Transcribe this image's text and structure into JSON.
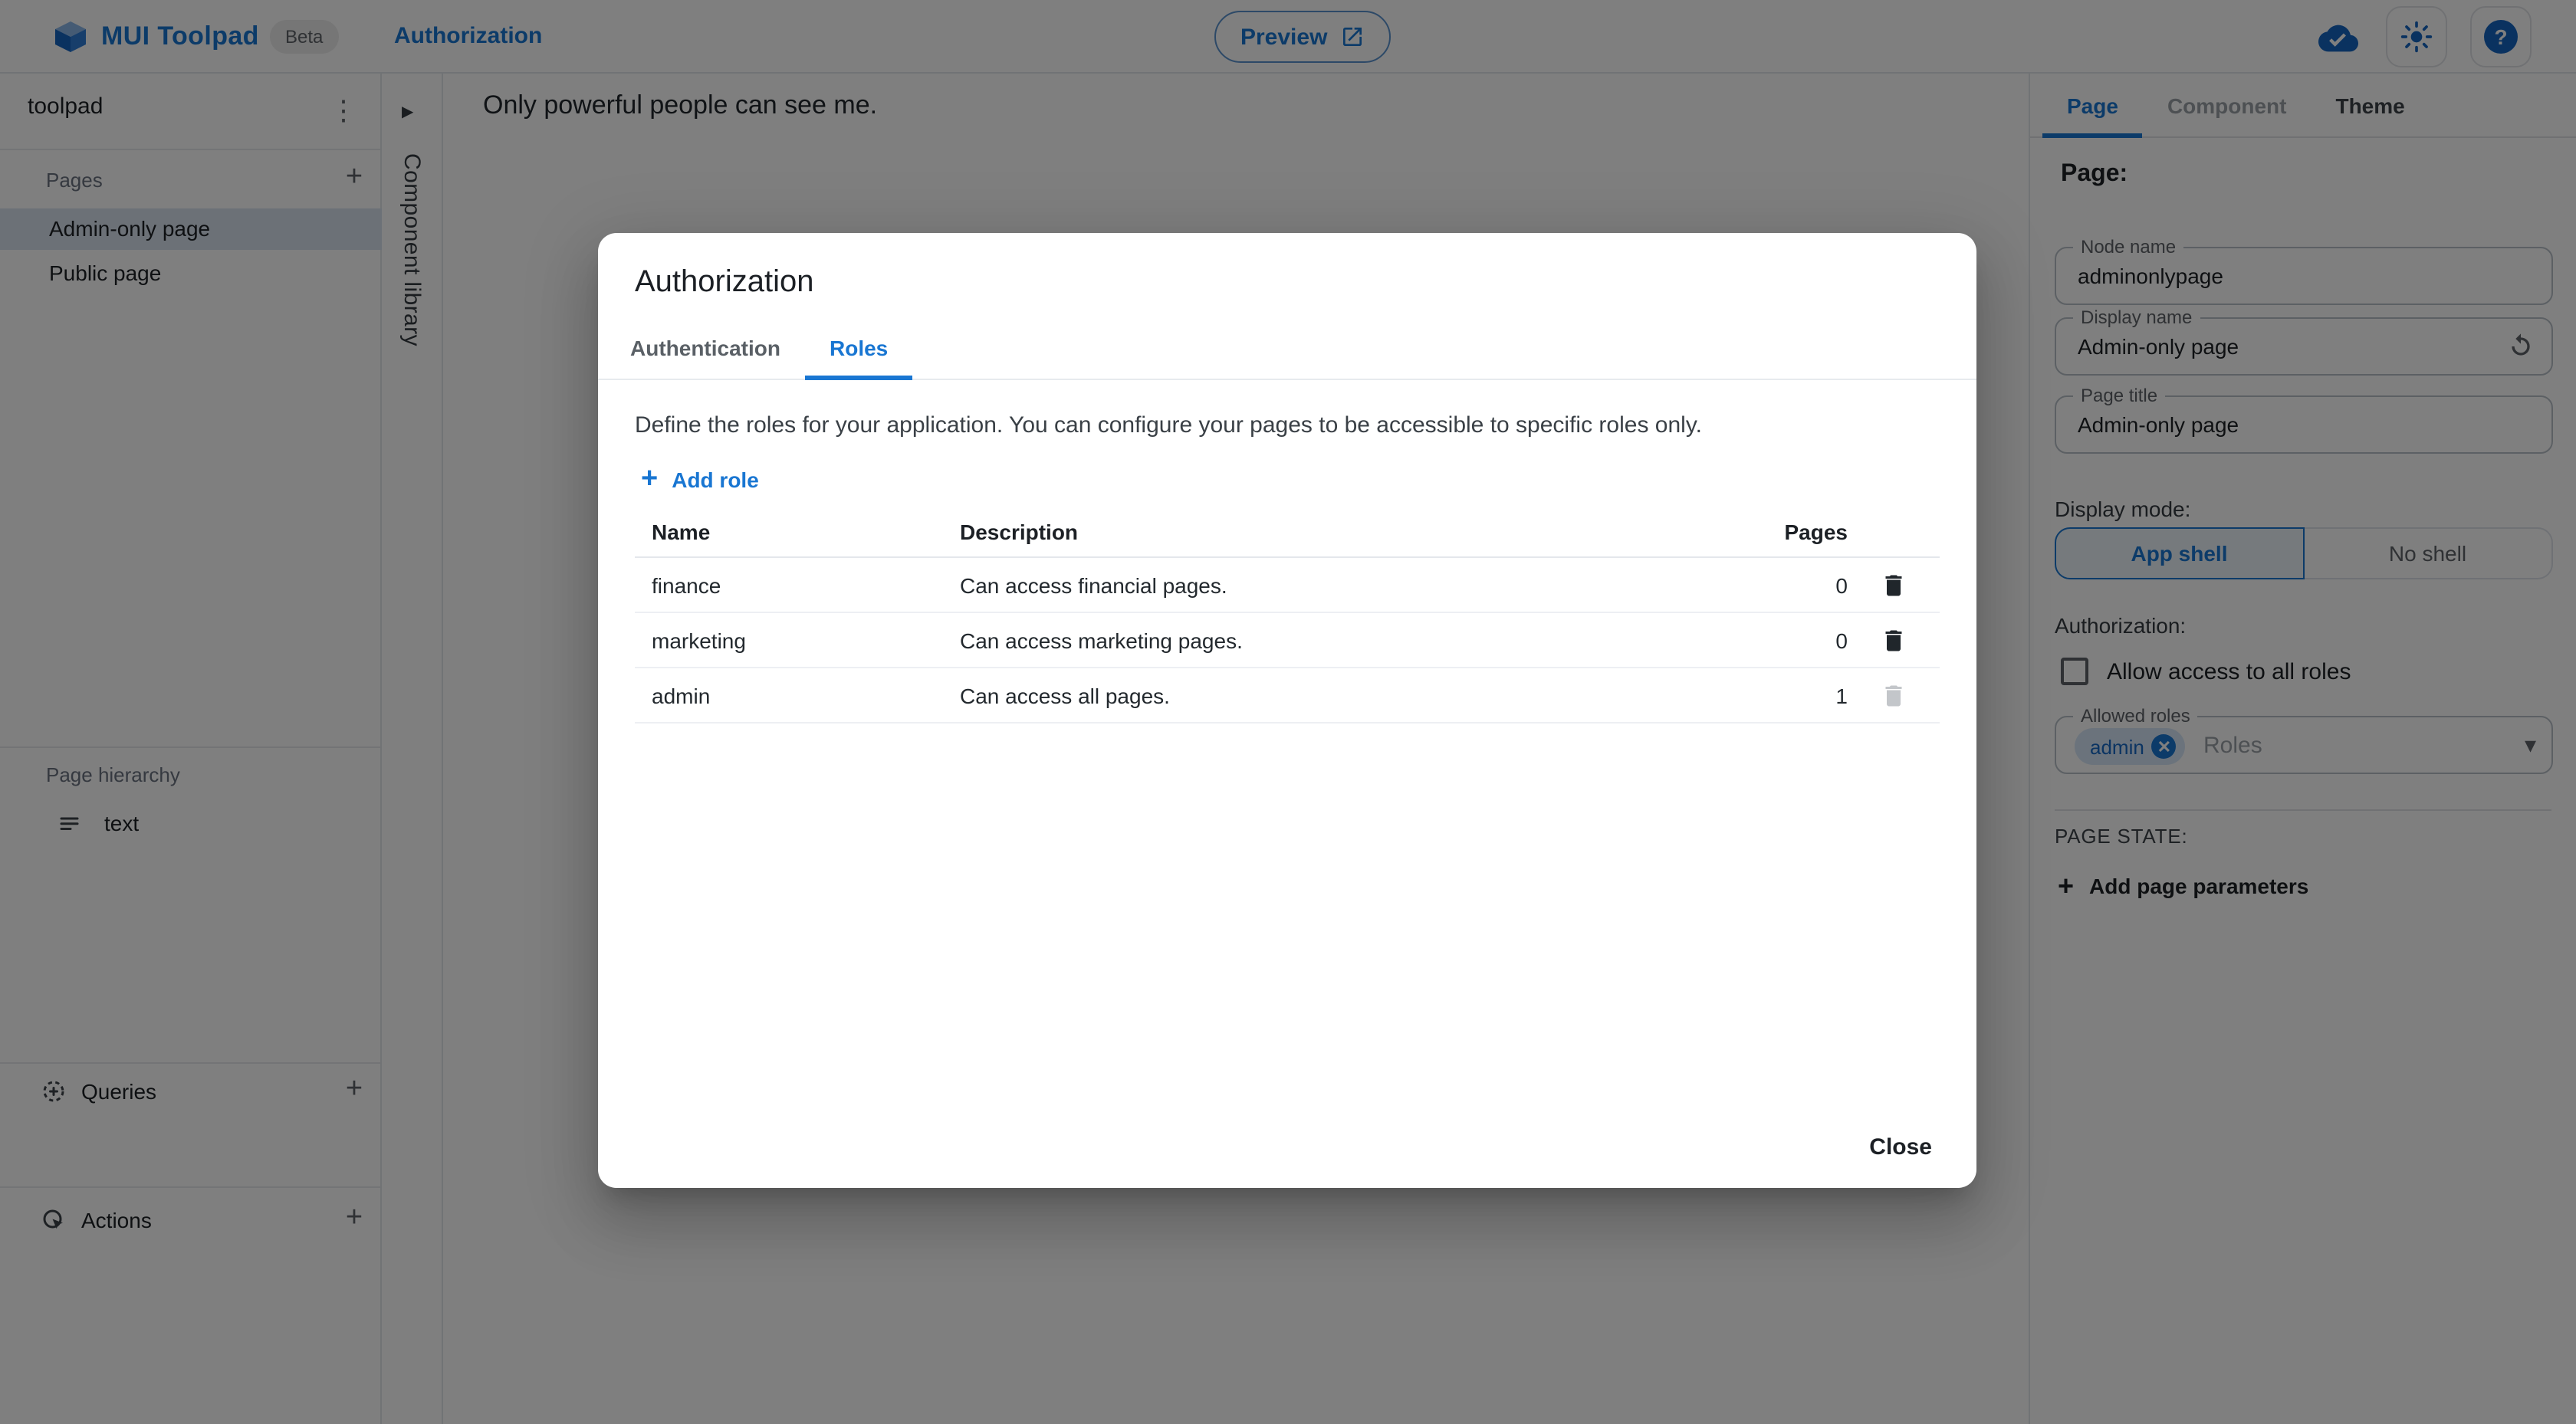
{
  "icons": {
    "kebab": "⋮",
    "plus": "+",
    "collapse_arrow": "▶",
    "dropdown": "▾",
    "help": "?",
    "chip_remove": "✕"
  },
  "colors": {
    "primary": "#1976d2",
    "selected_item_bg": "#d9e2ef",
    "backdrop": "rgba(0,0,0,0.5)",
    "border": "#e2e6ea",
    "text_primary": "#1c2025",
    "text_secondary": "#5f6368"
  },
  "header": {
    "app_title": "MUI Toolpad",
    "beta_label": "Beta",
    "nav_current": "Authorization",
    "preview_label": "Preview"
  },
  "sidebar": {
    "project_name": "toolpad",
    "pages_label": "Pages",
    "pages": [
      {
        "label": "Admin-only page",
        "selected": true
      },
      {
        "label": "Public page",
        "selected": false
      }
    ],
    "hierarchy_label": "Page hierarchy",
    "hierarchy_item": "text",
    "queries_label": "Queries",
    "actions_label": "Actions"
  },
  "component_library": {
    "label": "Component library"
  },
  "canvas": {
    "text": "Only powerful people can see me."
  },
  "dialog": {
    "title": "Authorization",
    "tabs": [
      {
        "label": "Authentication",
        "active": false
      },
      {
        "label": "Roles",
        "active": true
      }
    ],
    "description": "Define the roles for your application. You can configure your pages to be accessible to specific roles only.",
    "add_role_label": "Add role",
    "table": {
      "headers": {
        "name": "Name",
        "description": "Description",
        "pages": "Pages"
      },
      "rows": [
        {
          "name": "finance",
          "description": "Can access financial pages.",
          "pages": "0",
          "deletable": true
        },
        {
          "name": "marketing",
          "description": "Can access marketing pages.",
          "pages": "0",
          "deletable": true
        },
        {
          "name": "admin",
          "description": "Can access all pages.",
          "pages": "1",
          "deletable": false
        }
      ]
    },
    "close_label": "Close"
  },
  "inspector": {
    "tabs": [
      {
        "label": "Page",
        "state": "active"
      },
      {
        "label": "Component",
        "state": "disabled"
      },
      {
        "label": "Theme",
        "state": "enabled"
      }
    ],
    "section_title": "Page:",
    "fields": [
      {
        "label": "Node name",
        "value": "adminonlypage"
      },
      {
        "label": "Display name",
        "value": "Admin-only page"
      },
      {
        "label": "Page title",
        "value": "Admin-only page"
      }
    ],
    "display_mode_label": "Display mode:",
    "display_modes": [
      {
        "label": "App shell",
        "selected": true
      },
      {
        "label": "No shell",
        "selected": false
      }
    ],
    "authorization_label": "Authorization:",
    "allow_all_label": "Allow access to all roles",
    "allow_all_checked": false,
    "allowed_roles_label": "Allowed roles",
    "allowed_roles_chip": "admin",
    "allowed_roles_placeholder": "Roles",
    "page_state_label": "PAGE STATE:",
    "add_page_parameters_label": "Add page parameters"
  }
}
